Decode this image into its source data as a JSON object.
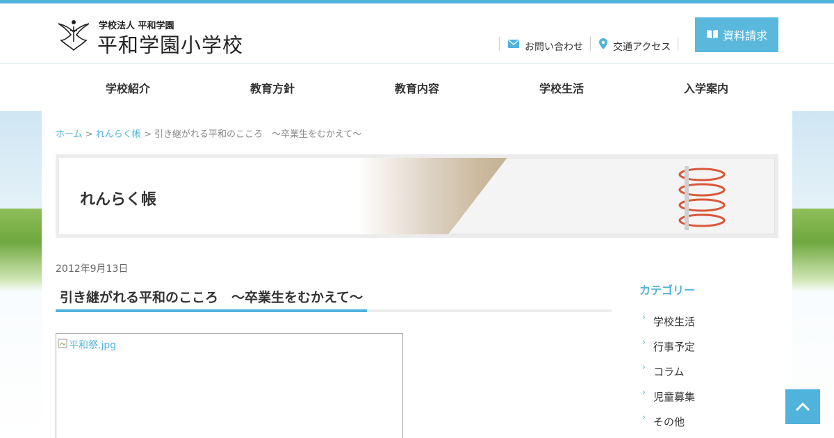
{
  "header": {
    "logo_sub": "学校法人 平和学園",
    "logo_main": "平和学園小学校",
    "links": [
      {
        "label": "お問い合わせ",
        "icon": "mail-icon"
      },
      {
        "label": "交通アクセス",
        "icon": "map-pin-icon"
      }
    ],
    "request_button": "資料請求"
  },
  "nav": {
    "items": [
      "学校紹介",
      "教育方針",
      "教育内容",
      "学校生活",
      "入学案内"
    ]
  },
  "breadcrumb": {
    "home": "ホーム",
    "sep1": " > ",
    "section": "れんらく帳",
    "sep2": " > ",
    "current": "引き継がれる平和のこころ　～卒業生をむかえて～"
  },
  "banner": {
    "title": "れんらく帳"
  },
  "post": {
    "date": "2012年9月13日",
    "title": "引き継がれる平和のこころ　～卒業生をむかえて～",
    "image_alt": "平和祭.jpg"
  },
  "sidebar": {
    "heading": "カテゴリー",
    "items": [
      "学校生活",
      "行事予定",
      "コラム",
      "児童募集",
      "その他"
    ]
  },
  "colors": {
    "accent": "#4fb3dc",
    "button": "#5ab8dc"
  }
}
